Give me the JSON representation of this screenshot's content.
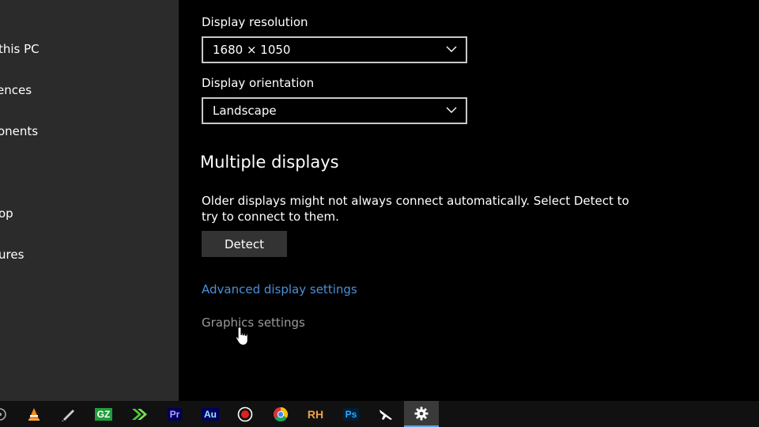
{
  "sidebar": {
    "items": [
      {
        "label": "this PC"
      },
      {
        "label": "ences"
      },
      {
        "label": "onents"
      },
      {
        "label": "op"
      },
      {
        "label": "ures"
      }
    ]
  },
  "main": {
    "resolution": {
      "label": "Display resolution",
      "value": "1680 × 1050"
    },
    "orientation": {
      "label": "Display orientation",
      "value": "Landscape"
    },
    "multiple_displays": {
      "title": "Multiple displays",
      "description": "Older displays might not always connect automatically. Select Detect to try to connect to them.",
      "detect_label": "Detect"
    },
    "links": {
      "advanced": "Advanced display settings",
      "graphics": "Graphics settings"
    }
  },
  "taskbar": {
    "icons": [
      {
        "name": "media-player-icon"
      },
      {
        "name": "vlc-icon"
      },
      {
        "name": "pen-tool-icon"
      },
      {
        "name": "gpu-z-icon",
        "text": "GZ"
      },
      {
        "name": "fast-forward-icon"
      },
      {
        "name": "premiere-pro-icon",
        "text": "Pr"
      },
      {
        "name": "audition-icon",
        "text": "Au"
      },
      {
        "name": "record-icon"
      },
      {
        "name": "chrome-icon"
      },
      {
        "name": "rh-icon",
        "text": "RH"
      },
      {
        "name": "photoshop-icon",
        "text": "Ps"
      },
      {
        "name": "airplane-icon"
      },
      {
        "name": "settings-gear-icon",
        "active": true
      }
    ]
  },
  "colors": {
    "accent_link": "#4a90d9",
    "sidebar_bg": "#2b2b2b",
    "taskbar_active_underline": "#5da0e6"
  }
}
